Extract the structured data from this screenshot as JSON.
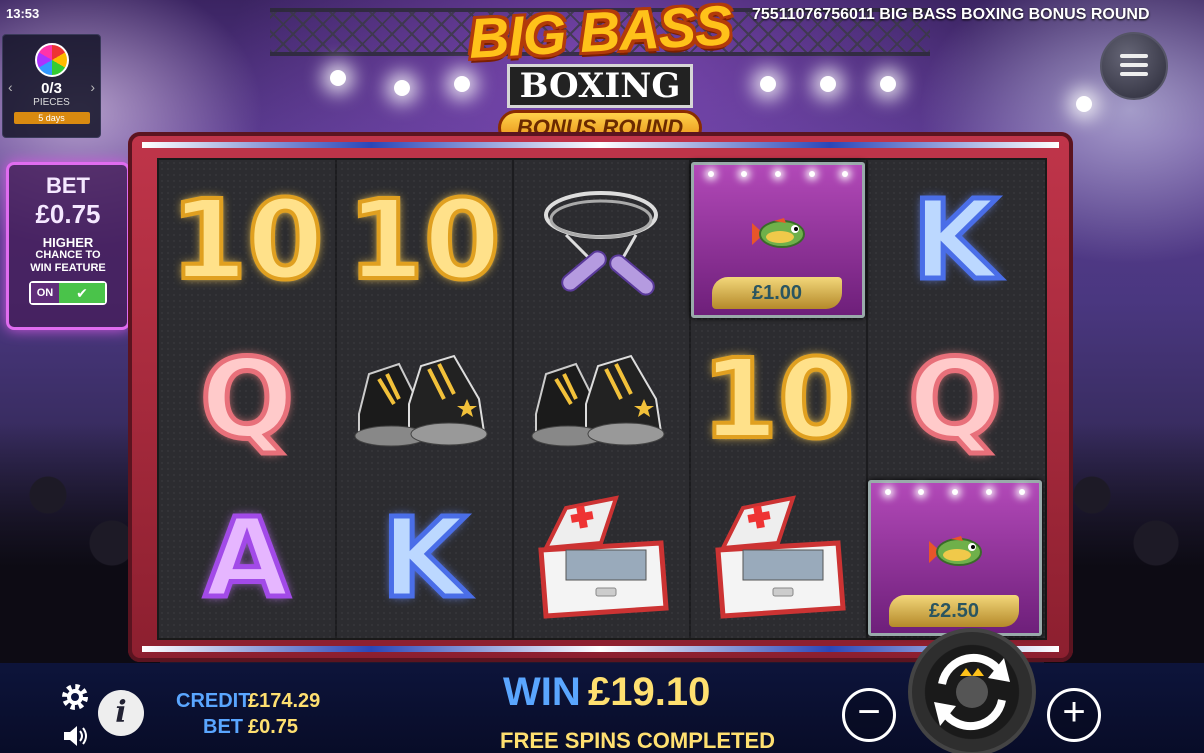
{
  "status": {
    "time": "13:53"
  },
  "header": {
    "round_id_title": "75511076756011 BIG BASS BOXING BONUS ROUND"
  },
  "logo": {
    "line1": "BIG BASS",
    "line2": "BOXING",
    "line3": "BONUS ROUND"
  },
  "pieces_panel": {
    "count": "0/3",
    "label": "PIECES",
    "timer": "5 days",
    "prev_icon": "chevron-left-icon",
    "next_icon": "chevron-right-icon"
  },
  "bet_panel": {
    "label": "BET",
    "value": "£0.75",
    "hint_line1": "HIGHER",
    "hint_line2": "CHANCE TO",
    "hint_line3": "WIN FEATURE",
    "toggle_label": "ON",
    "toggle_state": "on"
  },
  "reels": [
    [
      {
        "symbol": "10",
        "style": "gold"
      },
      {
        "symbol": "Q",
        "style": "pink"
      },
      {
        "symbol": "A",
        "style": "purple"
      }
    ],
    [
      {
        "symbol": "10",
        "style": "gold"
      },
      {
        "symbol": "boxing-boots",
        "style": "item"
      },
      {
        "symbol": "K",
        "style": "blue"
      }
    ],
    [
      {
        "symbol": "skipping-rope",
        "style": "item"
      },
      {
        "symbol": "boxing-boots",
        "style": "item"
      },
      {
        "symbol": "first-aid-kit",
        "style": "item"
      }
    ],
    [
      {
        "symbol": "fish-money",
        "style": "fish",
        "value": "£1.00"
      },
      {
        "symbol": "10",
        "style": "gold"
      },
      {
        "symbol": "first-aid-kit",
        "style": "item"
      }
    ],
    [
      {
        "symbol": "K",
        "style": "blue"
      },
      {
        "symbol": "Q",
        "style": "pink"
      },
      {
        "symbol": "fish-money",
        "style": "fish",
        "value": "£2.50"
      }
    ]
  ],
  "footer": {
    "credit_label": "CREDIT",
    "credit_value": "£174.29",
    "bet_label": "BET",
    "bet_value": "£0.75",
    "win_label": "WIN",
    "win_value": "£19.10",
    "status_message": "FREE SPINS COMPLETED",
    "minus_label": "−",
    "plus_label": "+"
  },
  "colors": {
    "accent_blue": "#5aa6ff",
    "accent_gold": "#ffe070",
    "bet_panel_border": "#e06cf0"
  }
}
